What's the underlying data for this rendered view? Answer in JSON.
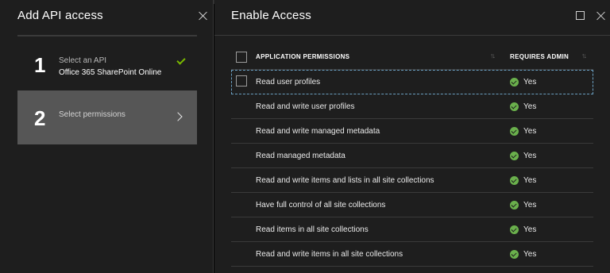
{
  "left_blade": {
    "title": "Add API access",
    "steps": [
      {
        "number": "1",
        "label": "Select an API",
        "value": "Office 365 SharePoint Online",
        "state": "complete"
      },
      {
        "number": "2",
        "label": "Select permissions",
        "value": "",
        "state": "active"
      }
    ]
  },
  "right_blade": {
    "title": "Enable Access",
    "columns": {
      "permission": "APPLICATION PERMISSIONS",
      "requires_admin": "REQUIRES ADMIN"
    },
    "rows": [
      {
        "permission": "Read user profiles",
        "requires_admin": "Yes",
        "has_checkbox": true,
        "selected": true
      },
      {
        "permission": "Read and write user profiles",
        "requires_admin": "Yes"
      },
      {
        "permission": "Read and write managed metadata",
        "requires_admin": "Yes"
      },
      {
        "permission": "Read managed metadata",
        "requires_admin": "Yes"
      },
      {
        "permission": "Read and write items and lists in all site collections",
        "requires_admin": "Yes"
      },
      {
        "permission": "Have full control of all site collections",
        "requires_admin": "Yes"
      },
      {
        "permission": "Read items in all site collections",
        "requires_admin": "Yes"
      },
      {
        "permission": "Read and write items in all site collections",
        "requires_admin": "Yes"
      }
    ]
  },
  "colors": {
    "background": "#1e1e1e",
    "active_step": "#565656",
    "check_green": "#7ab800",
    "status_green": "#6ab04c",
    "focus_outline": "#6a9ec0"
  },
  "icons": {
    "step1_status": "checkmark-icon",
    "step2_status": "chevron-right-icon",
    "close": "close-icon",
    "maximize": "maximize-icon",
    "sort": "sort-icon",
    "requires_admin": "green-check-circle-icon"
  }
}
